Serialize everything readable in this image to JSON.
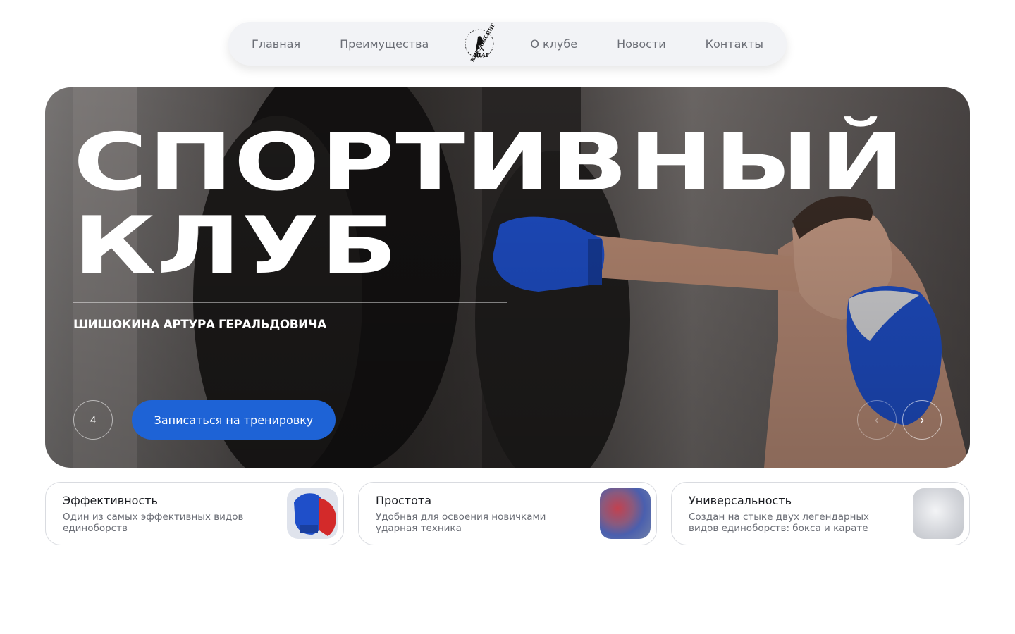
{
  "nav": {
    "items": [
      "Главная",
      "Преимущества",
      "О клубе",
      "Новости",
      "Контакты"
    ],
    "logo_top_text": "КИКБОКСИНГ",
    "logo_bottom_text": "ШАГ"
  },
  "hero": {
    "title_line1": "СПОРТИВНЫЙ",
    "title_line2": "КЛУБ",
    "subtitle": "ШИШОКИНА АРТУРА ГЕРАЛЬДОВИЧА",
    "slide_number": "4",
    "cta_label": "Записаться на тренировку",
    "prev_icon": "chevron-left-icon",
    "next_icon": "chevron-right-icon"
  },
  "features": [
    {
      "title": "Эффективность",
      "text": "Один из самых эффективных видов единоборств",
      "icon": "boxing-glove-icon"
    },
    {
      "title": "Простота",
      "text": "Удобная для освоения новичками ударная техника",
      "icon": "blurred-gloves-icon"
    },
    {
      "title": "Универсальность",
      "text": "Создан на стыке двух легендарных видов единоборств: бокса и карате",
      "icon": "blurred-light-icon"
    }
  ],
  "colors": {
    "accent": "#1e63d6",
    "nav_bg": "#f2f3f6",
    "glove_blue": "#1f4fc9"
  }
}
